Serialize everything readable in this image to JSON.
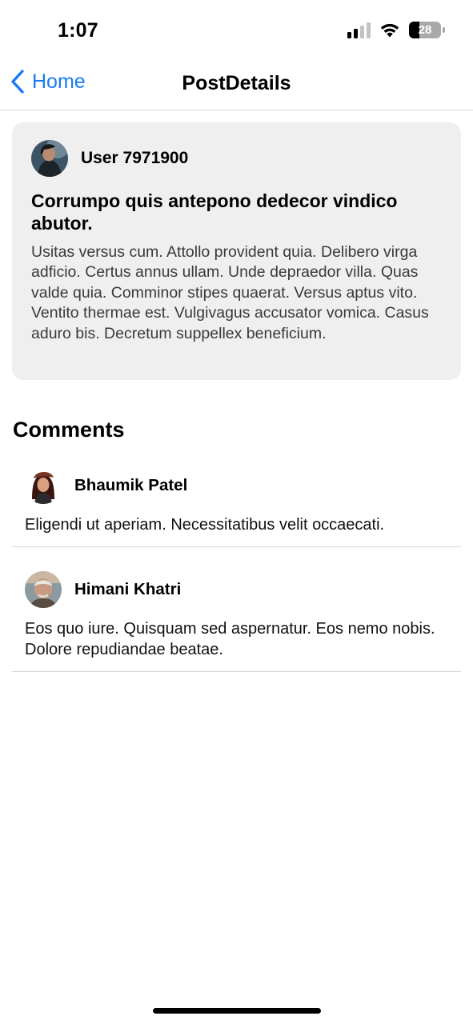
{
  "status_bar": {
    "time": "1:07",
    "battery": "28",
    "icons": [
      "signal-icon",
      "wifi-icon",
      "battery-icon"
    ]
  },
  "nav": {
    "back_label": "Home",
    "title": "PostDetails",
    "back_icon": "chevron-left-icon",
    "accent_color": "#1a7af5"
  },
  "post": {
    "author": "User 7971900",
    "title": "Corrumpo quis antepono dedecor vindico abutor.",
    "body": "Usitas versus cum. Attollo provident quia. Delibero virga adficio. Certus annus ullam. Unde depraedor villa. Quas valde quia. Comminor stipes quaerat. Versus aptus vito. Ventito thermae est. Vulgivagus accusator vomica. Casus aduro bis. Decretum suppellex beneficium."
  },
  "comments": {
    "heading": "Comments",
    "items": [
      {
        "name": "Bhaumik Patel",
        "text": "Eligendi ut aperiam. Necessitatibus velit occaecati."
      },
      {
        "name": "Himani Khatri",
        "text": "Eos quo iure. Quisquam sed aspernatur. Eos nemo nobis. Dolore repudiandae beatae."
      }
    ]
  }
}
